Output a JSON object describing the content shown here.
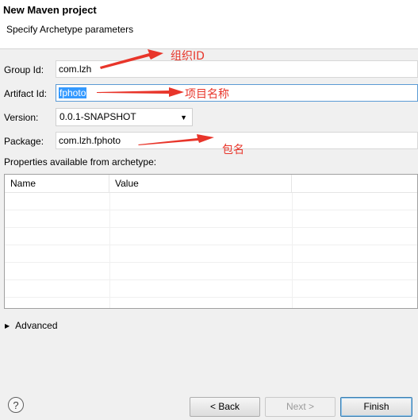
{
  "dialog": {
    "title": "New Maven project",
    "subtitle": "Specify Archetype parameters"
  },
  "form": {
    "group_id": {
      "label": "Group Id:",
      "value": "com.lzh"
    },
    "artifact_id": {
      "label": "Artifact Id:",
      "value": "fphoto"
    },
    "version": {
      "label": "Version:",
      "value": "0.0.1-SNAPSHOT"
    },
    "package": {
      "label": "Package:",
      "value": "com.lzh.fphoto"
    }
  },
  "properties": {
    "label": "Properties available from archetype:",
    "columns": [
      "Name",
      "Value"
    ],
    "rows": []
  },
  "advanced": {
    "label": "Advanced"
  },
  "buttons": {
    "help": "?",
    "back": "< Back",
    "next": "Next >",
    "finish": "Finish"
  },
  "annotations": {
    "group_id": "组织ID",
    "artifact_id": "项目名称",
    "package": "包名",
    "color": "#e8352a"
  }
}
